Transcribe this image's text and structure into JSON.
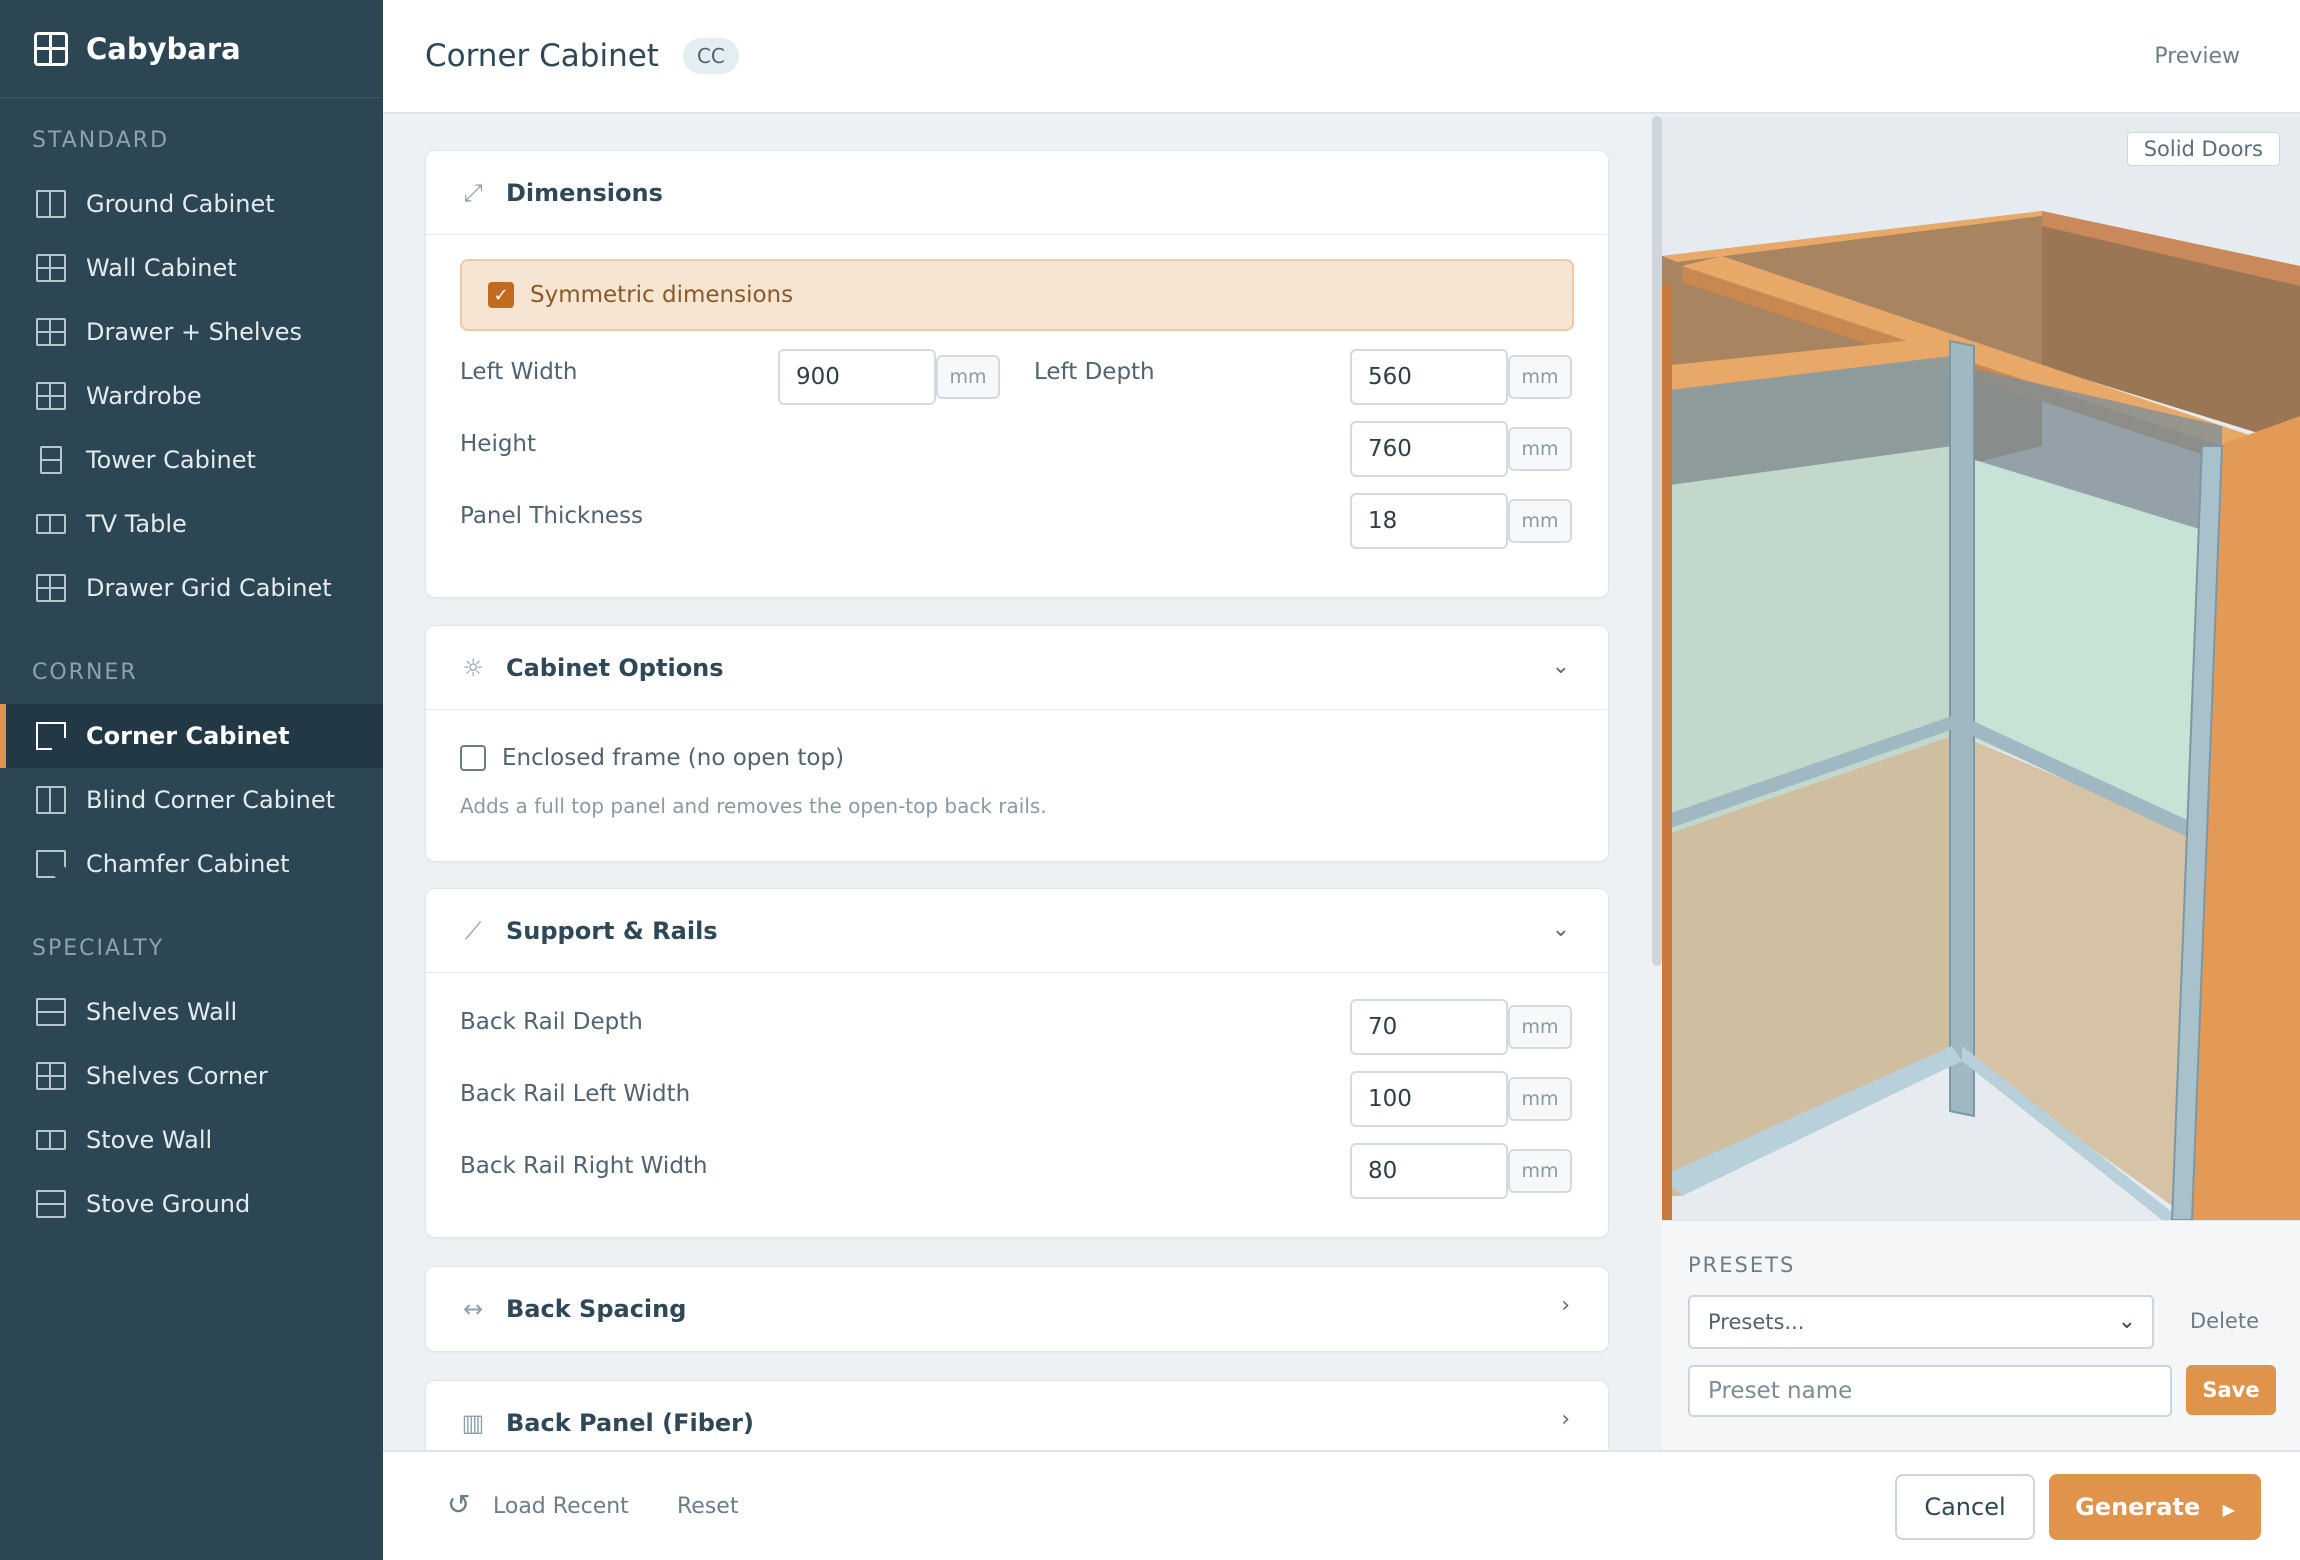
{
  "app": {
    "name": "Cabybara"
  },
  "sidebar": {
    "sections": {
      "standard": "STANDARD",
      "corner": "CORNER",
      "specialty": "SPECIALTY"
    },
    "standard_items": [
      "Ground Cabinet",
      "Wall Cabinet",
      "Drawer + Shelves",
      "Wardrobe",
      "Tower Cabinet",
      "TV Table",
      "Drawer Grid Cabinet"
    ],
    "corner_items": [
      "Corner Cabinet",
      "Blind Corner Cabinet",
      "Chamfer Cabinet"
    ],
    "specialty_items": [
      "Shelves Wall",
      "Shelves Corner",
      "Stove Wall",
      "Stove Ground"
    ],
    "active_item": "Corner Cabinet"
  },
  "header": {
    "title": "Corner Cabinet",
    "badge": "CC",
    "preview_label": "Preview"
  },
  "dimensions": {
    "title": "Dimensions",
    "symmetric_label": "Symmetric dimensions",
    "symmetric_checked": true,
    "left_width": {
      "label": "Left Width",
      "value": "900",
      "unit": "mm"
    },
    "left_depth": {
      "label": "Left Depth",
      "value": "560",
      "unit": "mm"
    },
    "height": {
      "label": "Height",
      "value": "760",
      "unit": "mm"
    },
    "panel_thickness": {
      "label": "Panel Thickness",
      "value": "18",
      "unit": "mm"
    }
  },
  "cabinet_options": {
    "title": "Cabinet Options",
    "enclosed_label": "Enclosed frame (no open top)",
    "enclosed_checked": false,
    "hint": "Adds a full top panel and removes the open-top back rails."
  },
  "support_rails": {
    "title": "Support & Rails",
    "back_rail_depth": {
      "label": "Back Rail Depth",
      "value": "70",
      "unit": "mm"
    },
    "back_rail_left_width": {
      "label": "Back Rail Left Width",
      "value": "100",
      "unit": "mm"
    },
    "back_rail_right_width": {
      "label": "Back Rail Right Width",
      "value": "80",
      "unit": "mm"
    }
  },
  "back_spacing": {
    "title": "Back Spacing"
  },
  "back_panel": {
    "title": "Back Panel (Fiber)"
  },
  "preview": {
    "mode_button": "Solid Doors"
  },
  "presets": {
    "label": "PRESETS",
    "select_value": "Presets...",
    "delete_label": "Delete",
    "name_placeholder": "Preset name",
    "save_label": "Save"
  },
  "footer": {
    "load_recent": "Load Recent",
    "reset": "Reset",
    "cancel": "Cancel",
    "generate": "Generate"
  },
  "colors": {
    "sidebar_bg": "#2c4653",
    "accent": "#e0944b",
    "wood": "#e8a868",
    "glass": "#a9c7d2"
  }
}
